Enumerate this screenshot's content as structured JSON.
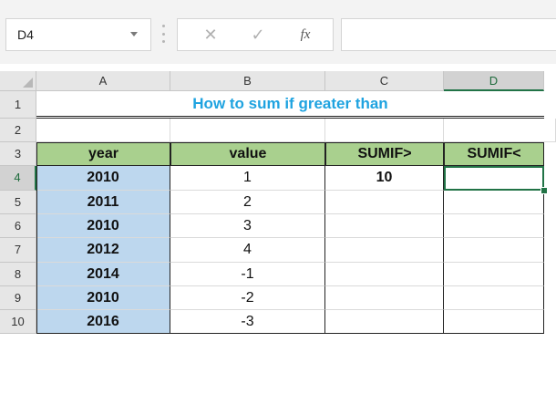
{
  "formula_bar": {
    "name_box": "D4",
    "cancel_icon": "close-icon",
    "enter_icon": "check-icon",
    "fx_label": "fx",
    "formula": ""
  },
  "columns": [
    "A",
    "B",
    "C",
    "D"
  ],
  "rows": [
    "1",
    "2",
    "3",
    "4",
    "5",
    "6",
    "7",
    "8",
    "9",
    "10"
  ],
  "title": "How to sum if greater than",
  "table": {
    "headers": [
      "year",
      "value",
      "SUMIF>",
      "SUMIF<"
    ],
    "rows": [
      {
        "year": "2010",
        "value": "1",
        "c": "10",
        "d": ""
      },
      {
        "year": "2011",
        "value": "2",
        "c": "",
        "d": ""
      },
      {
        "year": "2010",
        "value": "3",
        "c": "",
        "d": ""
      },
      {
        "year": "2012",
        "value": "4",
        "c": "",
        "d": ""
      },
      {
        "year": "2014",
        "value": "-1",
        "c": "",
        "d": ""
      },
      {
        "year": "2010",
        "value": "-2",
        "c": "",
        "d": ""
      },
      {
        "year": "2016",
        "value": "-3",
        "c": "",
        "d": ""
      }
    ]
  },
  "selected_cell": "D4",
  "colors": {
    "header_fill": "#a9d08e",
    "year_fill": "#bdd7ee",
    "title_text": "#1fa3e0",
    "selection": "#217346"
  }
}
